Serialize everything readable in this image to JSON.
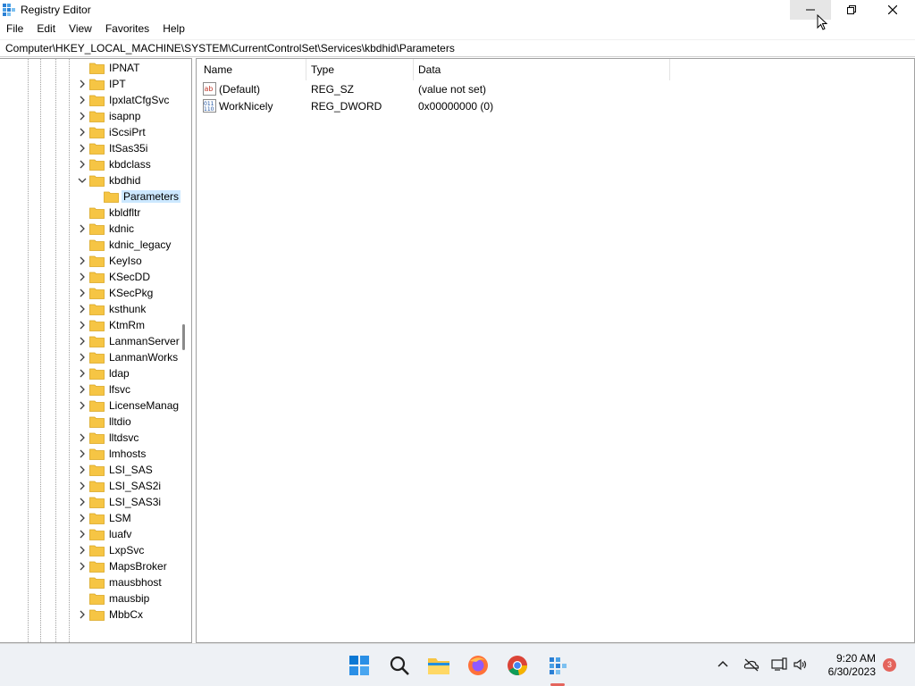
{
  "window": {
    "title": "Registry Editor"
  },
  "menu": [
    "File",
    "Edit",
    "View",
    "Favorites",
    "Help"
  ],
  "address": "Computer\\HKEY_LOCAL_MACHINE\\SYSTEM\\CurrentControlSet\\Services\\kbdhid\\Parameters",
  "tree": [
    {
      "label": "IPNAT",
      "expand": false
    },
    {
      "label": "IPT",
      "expand": true
    },
    {
      "label": "IpxlatCfgSvc",
      "expand": true
    },
    {
      "label": "isapnp",
      "expand": true
    },
    {
      "label": "iScsiPrt",
      "expand": true
    },
    {
      "label": "ItSas35i",
      "expand": true
    },
    {
      "label": "kbdclass",
      "expand": true
    },
    {
      "label": "kbdhid",
      "expand": "open"
    },
    {
      "label": "Parameters",
      "expand": "child",
      "selected": true
    },
    {
      "label": "kbldfltr",
      "expand": false
    },
    {
      "label": "kdnic",
      "expand": true
    },
    {
      "label": "kdnic_legacy",
      "expand": false
    },
    {
      "label": "KeyIso",
      "expand": true
    },
    {
      "label": "KSecDD",
      "expand": true
    },
    {
      "label": "KSecPkg",
      "expand": true
    },
    {
      "label": "ksthunk",
      "expand": true
    },
    {
      "label": "KtmRm",
      "expand": true
    },
    {
      "label": "LanmanServer",
      "expand": true
    },
    {
      "label": "LanmanWorks",
      "expand": true
    },
    {
      "label": "ldap",
      "expand": true
    },
    {
      "label": "lfsvc",
      "expand": true
    },
    {
      "label": "LicenseManag",
      "expand": true
    },
    {
      "label": "lltdio",
      "expand": false
    },
    {
      "label": "lltdsvc",
      "expand": true
    },
    {
      "label": "lmhosts",
      "expand": true
    },
    {
      "label": "LSI_SAS",
      "expand": true
    },
    {
      "label": "LSI_SAS2i",
      "expand": true
    },
    {
      "label": "LSI_SAS3i",
      "expand": true
    },
    {
      "label": "LSM",
      "expand": true
    },
    {
      "label": "luafv",
      "expand": true
    },
    {
      "label": "LxpSvc",
      "expand": true
    },
    {
      "label": "MapsBroker",
      "expand": true
    },
    {
      "label": "mausbhost",
      "expand": false
    },
    {
      "label": "mausbip",
      "expand": false
    },
    {
      "label": "MbbCx",
      "expand": true
    }
  ],
  "values": {
    "headers": [
      "Name",
      "Type",
      "Data"
    ],
    "rows": [
      {
        "icon": "string-value-icon",
        "name": "(Default)",
        "type": "REG_SZ",
        "data": "(value not set)"
      },
      {
        "icon": "binary-value-icon",
        "name": "WorkNicely",
        "type": "REG_DWORD",
        "data": "0x00000000 (0)"
      }
    ]
  },
  "taskbar": {
    "apps": [
      "start-icon",
      "search-icon",
      "file-explorer-icon",
      "firefox-icon",
      "chrome-icon",
      "regedit-icon"
    ],
    "time": "9:20 AM",
    "date": "6/30/2023",
    "notifications": "3"
  },
  "colors": {
    "selection": "#cce8ff",
    "folder": "#f6c544",
    "accent": "#e4645c"
  }
}
